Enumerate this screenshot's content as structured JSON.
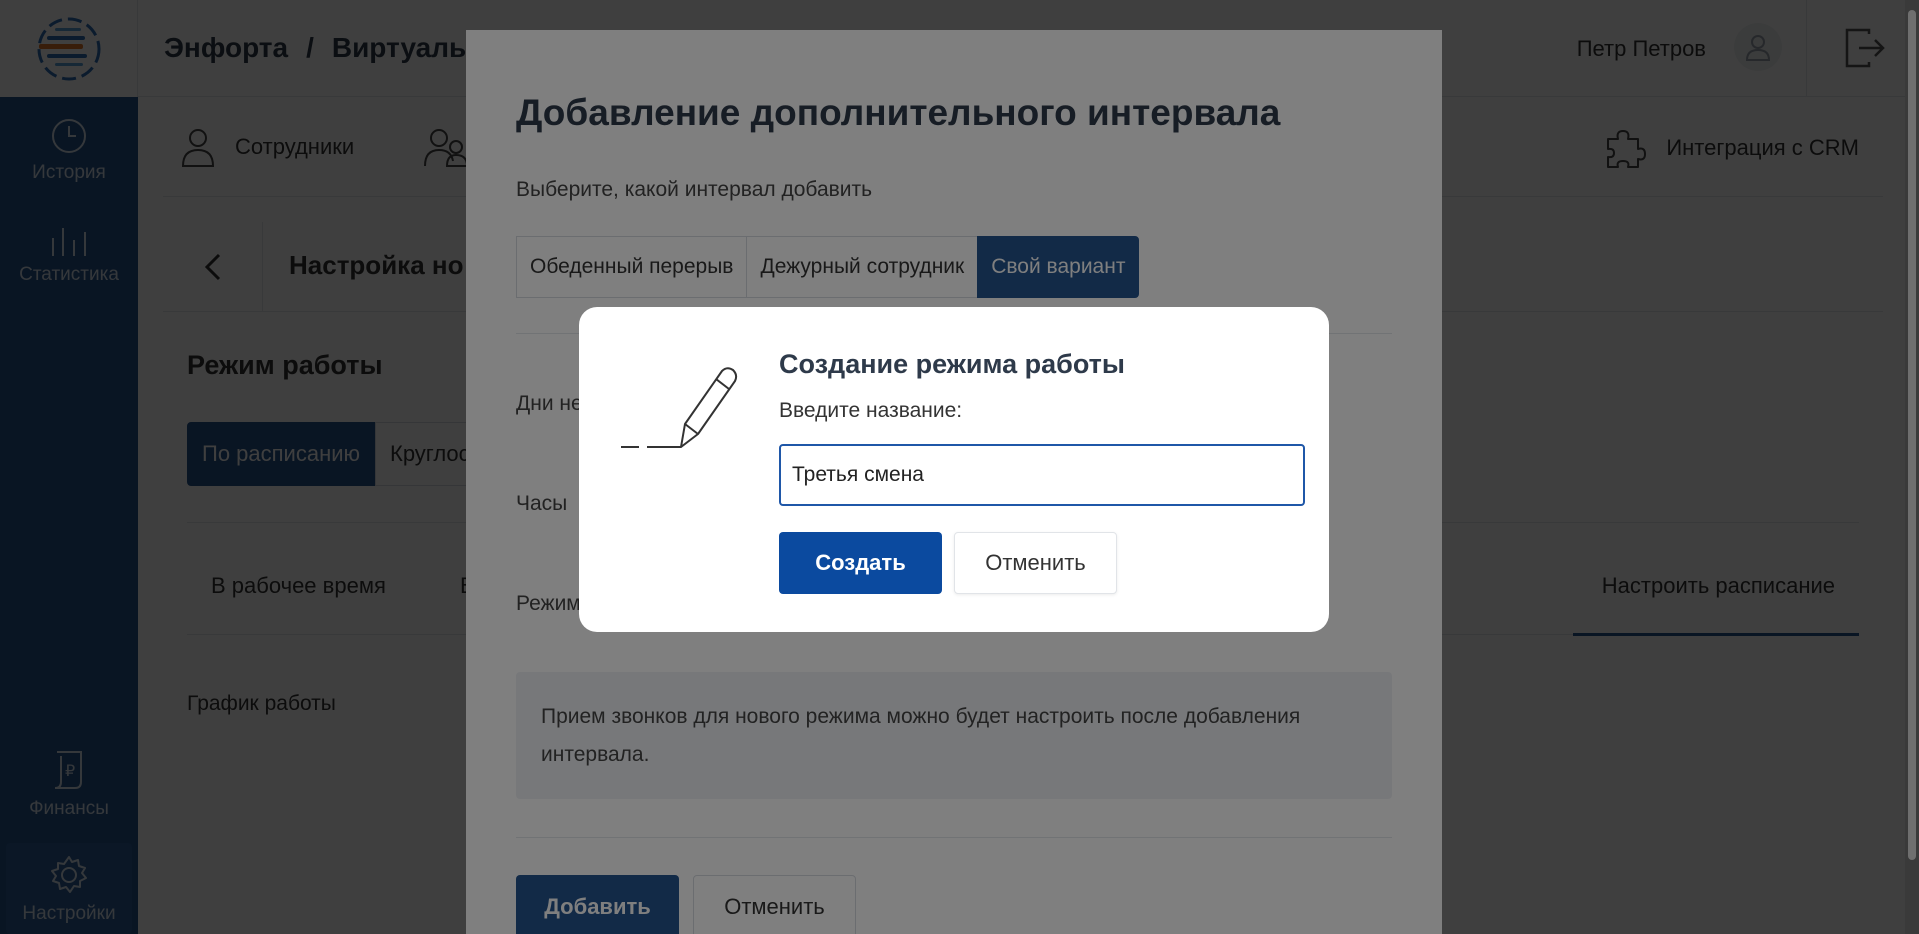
{
  "header": {
    "breadcrumb_root": "Энфорта",
    "breadcrumb_sep": "/",
    "breadcrumb_current": "Виртуальн",
    "user_name": "Петр Петров"
  },
  "sidebar": {
    "items": [
      {
        "label": "История",
        "icon": "clock-icon"
      },
      {
        "label": "Статистика",
        "icon": "bar-chart-icon"
      },
      {
        "label": "Финансы",
        "icon": "ruble-document-icon"
      },
      {
        "label": "Настройки",
        "icon": "gear-icon",
        "active": true
      }
    ]
  },
  "nav": {
    "tabs": [
      {
        "label": "Сотрудники",
        "icon": "person-icon"
      },
      {
        "label": "",
        "icon": "group-icon"
      },
      {
        "label": "Интеграция с CRM",
        "icon": "puzzle-icon"
      }
    ]
  },
  "page": {
    "title": "Настройка но",
    "section_title": "Режим работы",
    "modes": [
      "По расписанию",
      "Круглос"
    ],
    "subtabs": [
      "В рабочее время",
      "В",
      "Настроить расписание"
    ],
    "schedule_label": "График работы"
  },
  "interval_modal": {
    "title": "Добавление дополнительного интервала",
    "subtitle": "Выберите, какой интервал добавить",
    "options": [
      "Обеденный перерыв",
      "Дежурный сотрудник",
      "Свой вариант"
    ],
    "selected_option": "Свой вариант",
    "field_days": "Дни не",
    "field_hours": "Часы",
    "field_mode": "Режим",
    "info_text": "Прием звонков для нового режима можно будет настроить после добавления интервала.",
    "add_button": "Добавить",
    "cancel_button": "Отменить"
  },
  "create_dialog": {
    "title": "Создание режима работы",
    "label": "Введите название:",
    "input_value": "Третья смена",
    "create_button": "Создать",
    "cancel_button": "Отменить"
  },
  "colors": {
    "brand_blue": "#24548f",
    "primary_button": "#0b4a9f",
    "input_focus": "#1f57a8"
  }
}
